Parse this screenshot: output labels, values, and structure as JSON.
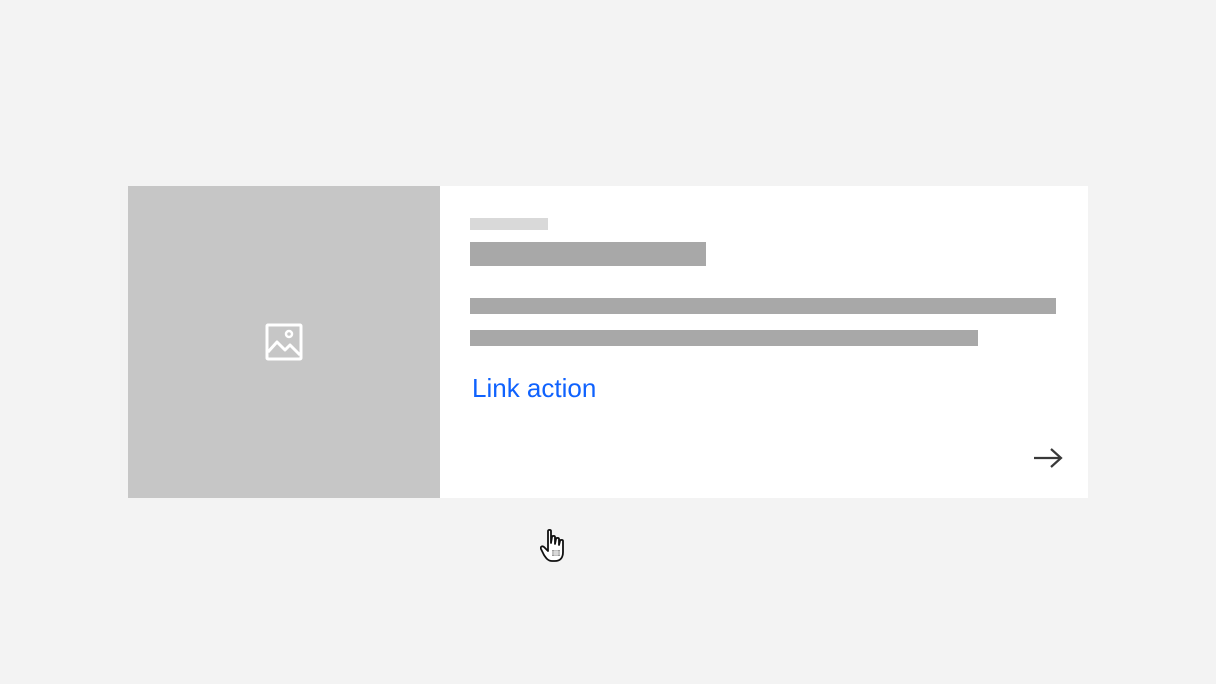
{
  "card": {
    "media_icon": "image-icon",
    "link_label": "Link action",
    "arrow_icon": "arrow-right-icon"
  },
  "cursor": {
    "icon": "hand-pointer-cursor-icon"
  },
  "colors": {
    "page_background": "#f3f3f3",
    "card_background": "#ffffff",
    "media_background": "#c6c6c6",
    "placeholder_light": "#d9d9d9",
    "placeholder_dark": "#a8a8a8",
    "link": "#0f62fe"
  }
}
